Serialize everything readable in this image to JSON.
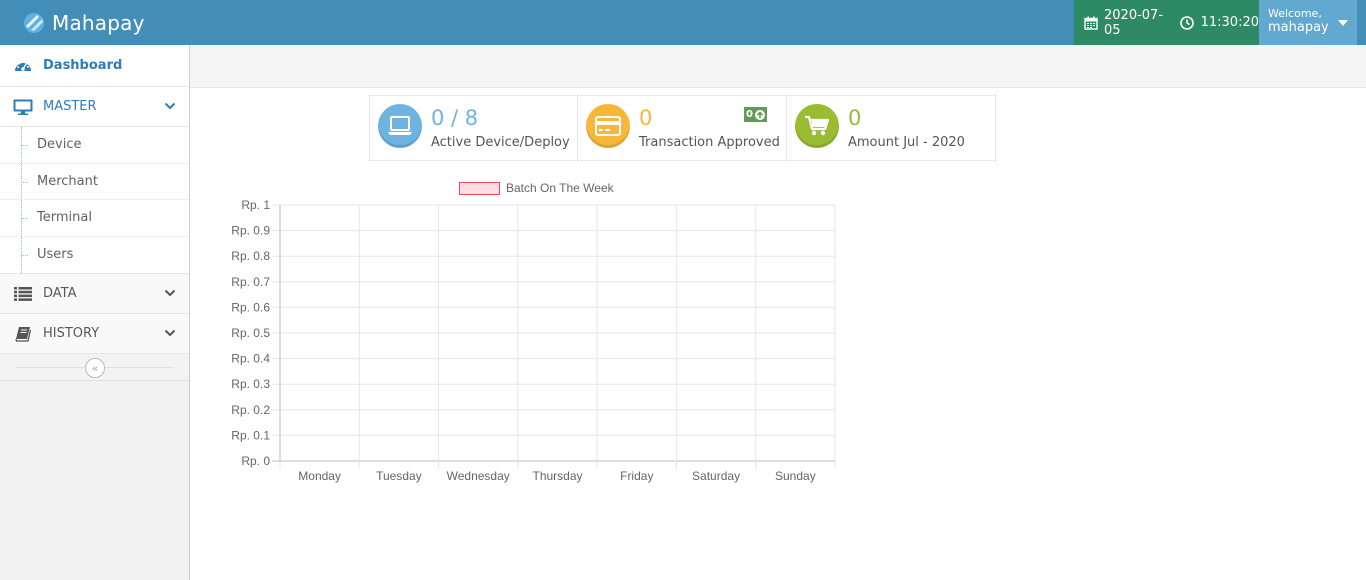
{
  "navbar": {
    "brand": "Mahapay",
    "date": "2020-07-05",
    "time": "11:30:20",
    "welcome": "Welcome,",
    "username": "mahapay",
    "colors": {
      "navbar": "#438eb9",
      "date_bg": "#2e8965",
      "user_bg": "#62a8d1"
    }
  },
  "sidebar": {
    "dashboard": "Dashboard",
    "master": {
      "label": "MASTER",
      "items": [
        "Device",
        "Merchant",
        "Terminal",
        "Users"
      ]
    },
    "data": "DATA",
    "history": "HISTORY",
    "icons": [
      "tachometer-icon",
      "desktop-icon",
      "list-icon",
      "book-icon",
      "chevron-down-icon",
      "double-angle-left-icon"
    ]
  },
  "infoboxes": [
    {
      "value": "0 / 8",
      "label": "Active Device/Deploy",
      "icon": "laptop-icon",
      "color": "#6fb3e0"
    },
    {
      "value": "0",
      "label": "Transaction Approved",
      "icon": "credit-card-icon",
      "color": "#f8b739",
      "badge": "0"
    },
    {
      "value": "0",
      "label": "Amount Jul - 2020",
      "icon": "shopping-cart-icon",
      "color": "#9abc32"
    }
  ],
  "chart_data": {
    "type": "bar",
    "legend": "Batch On The Week",
    "legend_position": "top",
    "categories": [
      "Monday",
      "Tuesday",
      "Wednesday",
      "Thursday",
      "Friday",
      "Saturday",
      "Sunday"
    ],
    "series": [
      {
        "name": "Batch On The Week",
        "values": [
          0,
          0,
          0,
          0,
          0,
          0,
          0
        ],
        "color": "#ffdde3",
        "border": "#e8485e"
      }
    ],
    "y_ticks": [
      "Rp. 1",
      "Rp. 0.9",
      "Rp. 0.8",
      "Rp. 0.7",
      "Rp. 0.6",
      "Rp. 0.5",
      "Rp. 0.4",
      "Rp. 0.3",
      "Rp. 0.2",
      "Rp. 0.1",
      "Rp. 0"
    ],
    "ylim": [
      0,
      1
    ],
    "grid": true
  }
}
